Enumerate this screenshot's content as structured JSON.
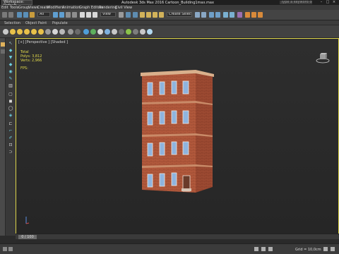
{
  "titlebar": {
    "workspace": "Workspace: Default",
    "title": "Autodesk 3ds Max 2016    Cartoon_Building1max.max",
    "search_placeholder": "Type a keyword or phrase"
  },
  "menubar": {
    "items": [
      "Edit",
      "Tools",
      "Group",
      "Views",
      "Create",
      "Modifiers",
      "Animation",
      "Graph Editors",
      "Rendering",
      "Civil View"
    ]
  },
  "toolbar": {
    "selection_filter": "All",
    "reference_coord": "View",
    "named_selection": "Create Selection Se"
  },
  "ribbon": {
    "tabs": [
      "Selection",
      "Object Paint",
      "Populate"
    ]
  },
  "viewport": {
    "label": "[+] [Perspective ] [Shaded ]",
    "stats_title": "Total",
    "polys_label": "Polys:",
    "polys_value": "3,812",
    "verts_label": "Verts:",
    "verts_value": "2,966",
    "fps_label": "FPS:"
  },
  "timeline": {
    "frame_display": "0 / 100"
  },
  "statusbar": {
    "grid": "Grid = 10,0cm"
  },
  "colors": {
    "viewport_border": "#ddd44a",
    "brick": "#b2593c",
    "window_glass": "#8fb4de",
    "stats_text": "#e4dc4a"
  }
}
